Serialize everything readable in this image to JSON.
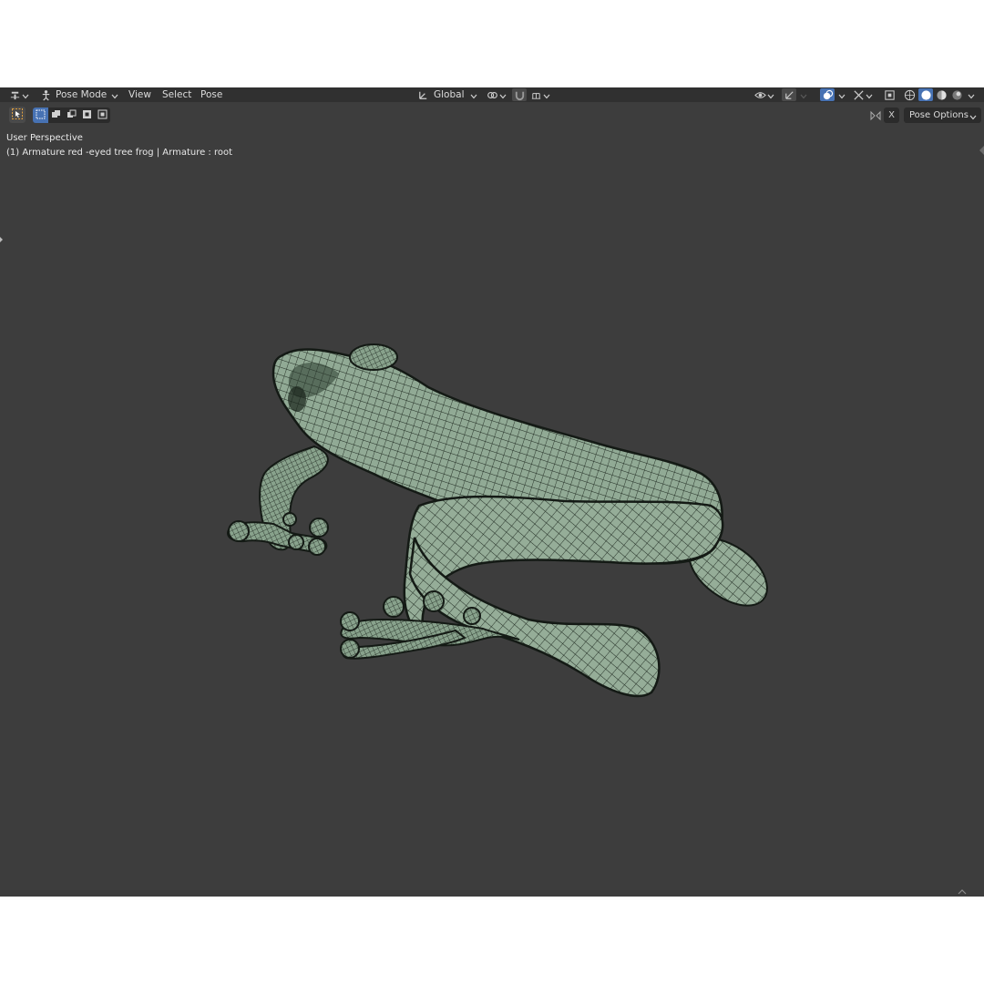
{
  "header": {
    "mode_label": "Pose Mode",
    "menus": [
      "View",
      "Select",
      "Pose"
    ],
    "transform_orientation": "Global",
    "icons": {
      "editor_type": "armature-editor-icon",
      "mode": "pose-mode-icon",
      "orientation": "transform-orientation-icon",
      "pivot": "pivot-point-icon",
      "snap": "snap-magnet-icon",
      "snap_target": "snap-increment-icon",
      "visibility": "object-visibility-icon",
      "gizmo": "gizmo-icon",
      "overlays": "overlays-icon",
      "xray": "xray-toggle-icon",
      "shading": [
        "wireframe-shading-icon",
        "solid-shading-icon",
        "material-shading-icon",
        "rendered-shading-icon"
      ]
    }
  },
  "toolbar": {
    "active_tool": "select-tweak-tool",
    "select_modes": [
      "select-new-mode",
      "select-extend-mode",
      "select-subtract-mode",
      "select-invert-mode",
      "select-intersect-mode"
    ],
    "mirror_toggle": "X",
    "pose_options_label": "Pose Options"
  },
  "viewport": {
    "perspective_label": "User Perspective",
    "object_info": "(1) Armature red -eyed tree frog | Armature : root",
    "background_color": "#3d3d3d",
    "mesh_color": "#8fa893",
    "wire_color": "#1d261f",
    "subject": "red-eyed tree frog wireframe mesh"
  },
  "colors": {
    "header_bg": "#303030",
    "accent": "#4772b3",
    "button_bg": "#2b2b2b"
  }
}
